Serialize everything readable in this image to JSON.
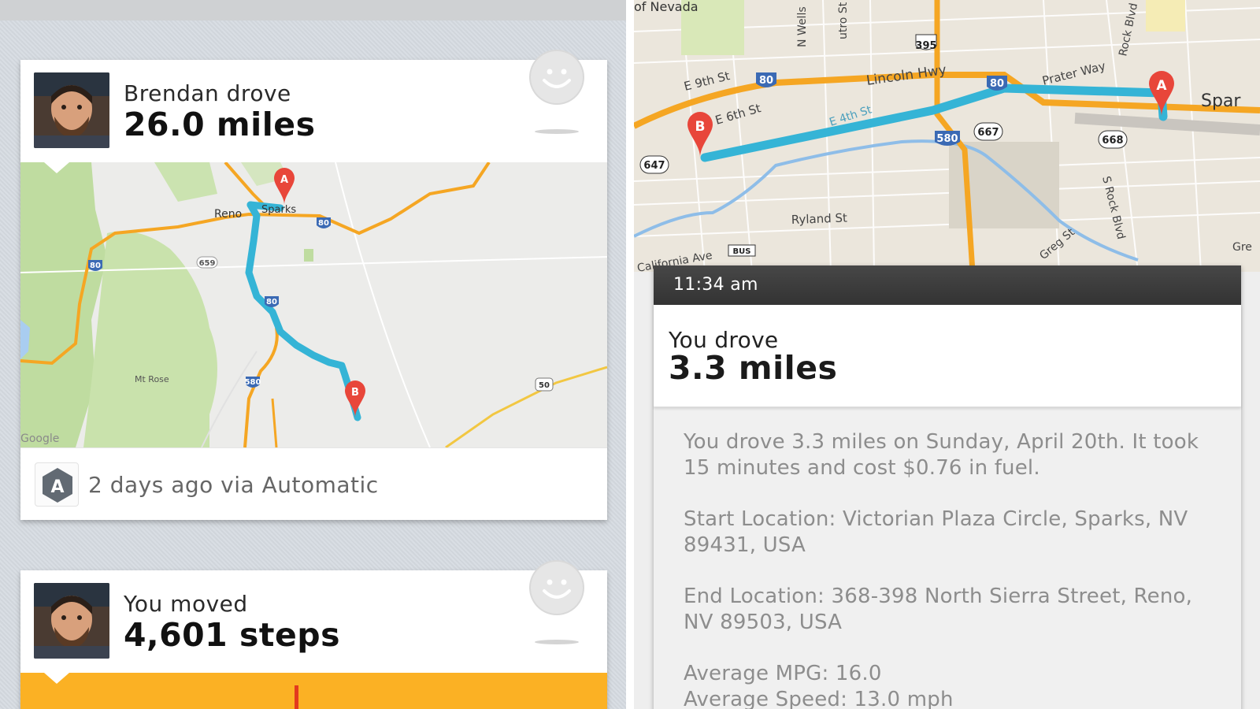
{
  "feed": {
    "drive_card": {
      "line1": "Brendan drove",
      "line2": "26.0 miles",
      "footer": "2 days ago via Automatic",
      "app_badge_letter": "A",
      "map": {
        "labels": [
          "Reno",
          "Sparks",
          "Mt Rose",
          "Google"
        ],
        "highway_shields": [
          "80",
          "80",
          "80",
          "659",
          "580",
          "580",
          "50"
        ],
        "markers": [
          "A",
          "B"
        ]
      }
    },
    "steps_card": {
      "line1": "You moved",
      "line2": "4,601 steps"
    }
  },
  "detail": {
    "time": "11:34 am",
    "line1": "You drove",
    "line2": "3.3 miles",
    "paragraphs": [
      "You drove 3.3 miles on Sunday, April 20th. It took 15 minutes and cost $0.76 in fuel.",
      "Start Location: Victorian Plaza Circle, Sparks, NV 89431, USA",
      "End Location: 368-398 North Sierra Street, Reno, NV 89503, USA",
      "Average MPG: 16.0",
      "Average Speed: 13.0 mph"
    ],
    "map": {
      "street_labels": [
        "of Nevada",
        "N Wells",
        "utro St",
        "Lincoln Hwy",
        "E 9th St",
        "E 6th St",
        "E 4th St",
        "Prater Way",
        "Rock Blvd",
        "S Rock Blvd",
        "Ryland St",
        "Greg St",
        "California Ave",
        "Spar",
        "Gre"
      ],
      "highway_shields": [
        "395",
        "80",
        "80",
        "580",
        "667",
        "668",
        "647",
        "BUS"
      ],
      "markers": [
        "A",
        "B"
      ]
    }
  },
  "colors": {
    "route": "#35b4d6",
    "highway": "#f5a623",
    "marker": "#e8463a",
    "steps_bar": "#fbb124",
    "detail_header": "#3c3c3c"
  }
}
